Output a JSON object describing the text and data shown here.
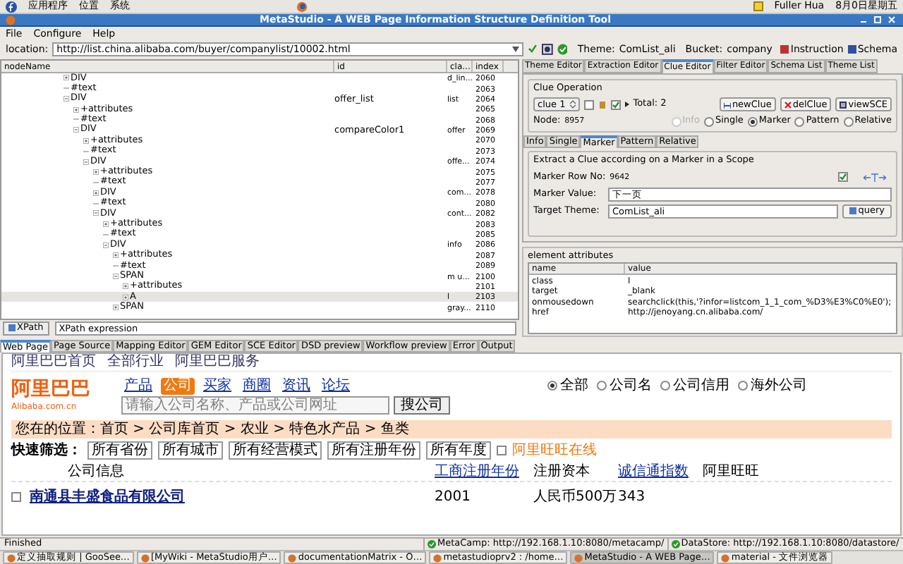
{
  "desktop_bar": {
    "menus": [
      "应用程序",
      "位置",
      "系统"
    ],
    "user": "Fuller Hua",
    "datetime": "8月0日星期五"
  },
  "window": {
    "title": "MetaStudio - A WEB Page Information Structure Definition Tool"
  },
  "menu": [
    "File",
    "Configure",
    "Help"
  ],
  "location": {
    "label": "location:",
    "value": "http://list.china.alibaba.com/buyer/companylist/10002.html",
    "theme_label": "Theme:",
    "theme": "ComList_ali",
    "bucket_label": "Bucket:",
    "bucket": "company",
    "buttons": [
      "Instruction",
      "Schema"
    ]
  },
  "tree": {
    "columns": [
      "nodeName",
      "id",
      "cla...",
      "index"
    ],
    "rows": [
      {
        "name": "DIV",
        "cls": "d_lin...",
        "index": "2060",
        "expanded": false,
        "selected": false
      },
      {
        "name": "#text",
        "index": "2063",
        "selected": false
      },
      {
        "name": "DIV",
        "id": "offer_list",
        "cls": "list",
        "index": "2064",
        "expanded": true,
        "selected": false,
        "children": [
          {
            "name": "+attributes",
            "index": "2065",
            "expanded": false,
            "selected": false
          },
          {
            "name": "#text",
            "index": "2068",
            "selected": false
          },
          {
            "name": "DIV",
            "id": "compareColor1",
            "cls": "offer",
            "index": "2069",
            "expanded": true,
            "selected": false,
            "children": [
              {
                "name": "+attributes",
                "index": "2070",
                "expanded": false,
                "selected": false
              },
              {
                "name": "#text",
                "index": "2073",
                "selected": false
              },
              {
                "name": "DIV",
                "cls": "offe...",
                "index": "2074",
                "expanded": true,
                "selected": false,
                "children": [
                  {
                    "name": "+attributes",
                    "index": "2075",
                    "expanded": false,
                    "selected": false
                  },
                  {
                    "name": "#text",
                    "index": "2077",
                    "selected": false
                  },
                  {
                    "name": "DIV",
                    "cls": "com...",
                    "index": "2078",
                    "expanded": false,
                    "selected": false
                  },
                  {
                    "name": "#text",
                    "index": "2080",
                    "selected": false
                  },
                  {
                    "name": "DIV",
                    "cls": "cont...",
                    "index": "2082",
                    "expanded": true,
                    "selected": false,
                    "children": [
                      {
                        "name": "+attributes",
                        "index": "2083",
                        "expanded": false,
                        "selected": false
                      },
                      {
                        "name": "#text",
                        "index": "2085",
                        "selected": false
                      },
                      {
                        "name": "DIV",
                        "cls": "info",
                        "index": "2086",
                        "expanded": true,
                        "selected": false,
                        "children": [
                          {
                            "name": "+attributes",
                            "index": "2087",
                            "expanded": false,
                            "selected": false
                          },
                          {
                            "name": "#text",
                            "index": "2089",
                            "selected": false
                          },
                          {
                            "name": "SPAN",
                            "cls": "m u...",
                            "index": "2100",
                            "expanded": true,
                            "selected": false,
                            "children": [
                              {
                                "name": "+attributes",
                                "index": "2101",
                                "expanded": false,
                                "selected": false
                              },
                              {
                                "name": "A",
                                "cls": "l",
                                "index": "2103",
                                "expanded": false,
                                "selected": true
                              }
                            ]
                          },
                          {
                            "name": "SPAN",
                            "cls": "gray...",
                            "index": "2110",
                            "expanded": false,
                            "selected": false
                          }
                        ]
                      }
                    ]
                  }
                ]
              }
            ]
          }
        ]
      }
    ]
  },
  "xpath": {
    "button": "XPath",
    "value": "XPath expression"
  },
  "editor_tabs": [
    {
      "label": "Theme Editor",
      "selected": false
    },
    {
      "label": "Extraction Editor",
      "selected": false
    },
    {
      "label": "Clue Editor",
      "selected": true
    },
    {
      "label": "Filter Editor",
      "selected": false
    },
    {
      "label": "Schema List",
      "selected": false
    },
    {
      "label": "Theme List",
      "selected": false
    }
  ],
  "clue_operation": {
    "title": "Clue Operation",
    "clue": "clue 1",
    "checkbox_checked": false,
    "check2_checked": true,
    "total": "Total:  2",
    "buttons": [
      "newClue",
      "delClue",
      "viewSCE"
    ],
    "node_label": "Node:",
    "node": "8957",
    "modes": [
      {
        "label": "Info",
        "selected": false,
        "disabled": true
      },
      {
        "label": "Single",
        "selected": false,
        "disabled": false
      },
      {
        "label": "Marker",
        "selected": true,
        "disabled": false
      },
      {
        "label": "Pattern",
        "selected": false,
        "disabled": false
      },
      {
        "label": "Relative",
        "selected": false,
        "disabled": false
      }
    ]
  },
  "clue_tabs": [
    {
      "label": "Info",
      "selected": false
    },
    {
      "label": "Single",
      "selected": false
    },
    {
      "label": "Marker",
      "selected": true
    },
    {
      "label": "Pattern",
      "selected": false
    },
    {
      "label": "Relative",
      "selected": false
    }
  ],
  "marker": {
    "title": "Extract a Clue according on a Marker in a Scope",
    "row_label": "Marker Row No:",
    "row": "9642",
    "checked": true,
    "value_label": "Marker Value:",
    "value": "下一页",
    "theme_label": "Target Theme:",
    "theme": "ComList_ali",
    "query": "query"
  },
  "attributes": {
    "title": "element attributes",
    "columns": [
      "name",
      "value"
    ],
    "rows": [
      [
        "class",
        "l"
      ],
      [
        "target",
        "_blank"
      ],
      [
        "onmousedown",
        "searchclick(this,'?infor=listcom_1_1_com_%D3%E3%C0%E0');"
      ],
      [
        "href",
        "http://jenoyang.cn.alibaba.com/"
      ]
    ]
  },
  "view_tabs": [
    {
      "label": "Web Page",
      "selected": true
    },
    {
      "label": "Page Source",
      "selected": false
    },
    {
      "label": "Mapping Editor",
      "selected": false
    },
    {
      "label": "GEM Editor",
      "selected": false
    },
    {
      "label": "SCE Editor",
      "selected": false
    },
    {
      "label": "DSD preview",
      "selected": false
    },
    {
      "label": "Workflow preview",
      "selected": false
    },
    {
      "label": "Error",
      "selected": false
    },
    {
      "label": "Output",
      "selected": false
    }
  ],
  "web_page": {
    "nav": [
      "阿里巴巴首页",
      "全部行业",
      "阿里巴巴服务"
    ],
    "logo": "阿里巴巴",
    "logo_sub": "Alibaba.com.cn",
    "search_tabs": [
      {
        "label": "产品",
        "selected": false
      },
      {
        "label": "公司",
        "selected": true
      },
      {
        "label": "买家",
        "selected": false
      },
      {
        "label": "商圈",
        "selected": false
      },
      {
        "label": "资讯",
        "selected": false
      },
      {
        "label": "论坛",
        "selected": false
      }
    ],
    "search_placeholder": "请输入公司名称、产品或公司网址",
    "search_button": "搜公司",
    "scopes": [
      {
        "label": "全部",
        "selected": true
      },
      {
        "label": "公司名",
        "selected": false
      },
      {
        "label": "公司信用",
        "selected": false
      },
      {
        "label": "海外公司",
        "selected": false
      }
    ],
    "breadcrumb": "您在的位置：首页 > 公司库首页 > 农业 > 特色水产品 > 鱼类",
    "filter_label": "快速筛选：",
    "filters": [
      "所有省份",
      "所有城市",
      "所有经营模式",
      "所有注册年份",
      "所有年度"
    ],
    "online_label": "阿里旺旺在线",
    "online_checked": false,
    "columns": [
      "公司信息",
      "工商注册年份",
      "注册资本",
      "诚信通指数",
      "阿里旺旺"
    ],
    "company": {
      "name": "南通县丰盛食品有限公司",
      "checked": false,
      "year": "2001",
      "capital": "人民币500万",
      "index": "343"
    }
  },
  "status_bar": {
    "text": "Finished",
    "services": [
      "MetaCamp: http://192.168.1.10:8080/metacamp/",
      "DataStore: http://192.168.1.10:8080/datastore/"
    ]
  },
  "taskbar": [
    {
      "label": "定义抽取规则 | GooSee…",
      "selected": false
    },
    {
      "label": "[MyWiki - MetaStudio用户…",
      "selected": false
    },
    {
      "label": "documentationMatrix - O…",
      "selected": false
    },
    {
      "label": "metastudioprv2 : /home…",
      "selected": false
    },
    {
      "label": "MetaStudio - A WEB Page…",
      "selected": true
    },
    {
      "label": "material - 文件浏览器",
      "selected": false
    }
  ]
}
